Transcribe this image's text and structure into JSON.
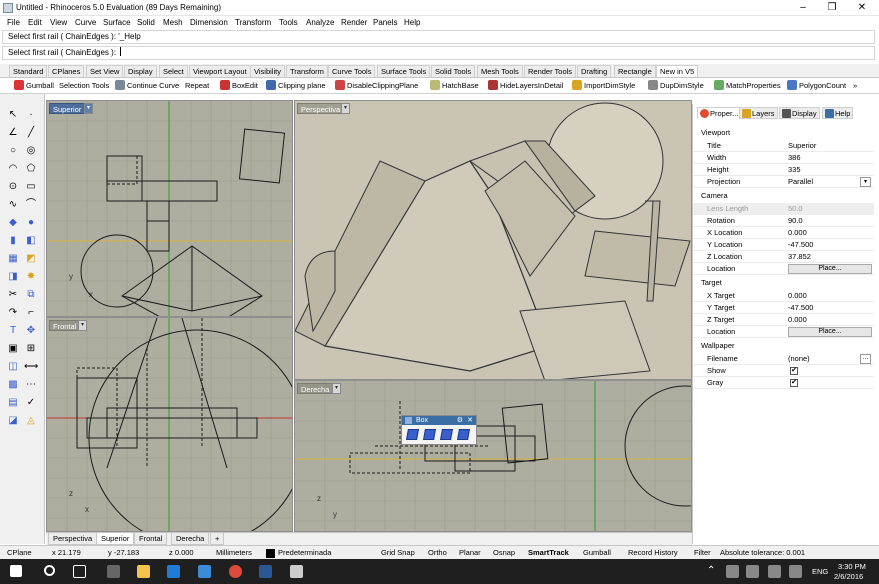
{
  "window": {
    "title": "Untitled - Rhinoceros 5.0 Evaluation (89 Days Remaining)",
    "min": "–",
    "max": "❐",
    "close": "✕"
  },
  "menu": [
    "File",
    "Edit",
    "View",
    "Curve",
    "Surface",
    "Solid",
    "Mesh",
    "Dimension",
    "Transform",
    "Tools",
    "Analyze",
    "Render",
    "Panels",
    "Help"
  ],
  "command": {
    "history": "Select first rail ( ChainEdges ): '_Help",
    "prompt": "Select first rail ( ChainEdges ):"
  },
  "toolbar_tabs": [
    "Standard",
    "CPlanes",
    "Set View",
    "Display",
    "Select",
    "Viewport Layout",
    "Visibility",
    "Transform",
    "Curve Tools",
    "Surface Tools",
    "Solid Tools",
    "Mesh Tools",
    "Render Tools",
    "Drafting",
    "Rectangle",
    "New in V5"
  ],
  "tools": [
    "Gumball",
    "Selection Tools",
    "Continue Curve",
    "Repeat",
    "BoxEdit",
    "Clipping plane",
    "DisableClippingPlane",
    "HatchBase",
    "HideLayersInDetail",
    "ImportDimStyle",
    "DupDimStyle",
    "MatchProperties",
    "PolygonCount"
  ],
  "tool_more": "»",
  "viewports": {
    "top": "Superior",
    "persp": "Perspectiva",
    "front": "Frontal",
    "right": "Derecha"
  },
  "viewport_tabs": [
    "Perspectiva",
    "Superior",
    "Frontal",
    "Derecha"
  ],
  "add_tab": "+",
  "axes": {
    "top": {
      "y": "y",
      "x": "x"
    },
    "front": {
      "z": "z",
      "x": "x"
    },
    "right": {
      "z": "z",
      "y": "y"
    }
  },
  "box_palette": {
    "title": "Box"
  },
  "panel": {
    "tabs": [
      "Proper...",
      "Layers",
      "Display",
      "Help"
    ],
    "viewport_section": "Viewport",
    "viewport_rows": [
      {
        "k": "Title",
        "v": "Superior"
      },
      {
        "k": "Width",
        "v": "386"
      },
      {
        "k": "Height",
        "v": "335"
      },
      {
        "k": "Projection",
        "v": "Parallel"
      }
    ],
    "camera_section": "Camera",
    "camera_rows": [
      {
        "k": "Lens Length",
        "v": "50.0"
      },
      {
        "k": "Rotation",
        "v": "90.0"
      },
      {
        "k": "X Location",
        "v": "0.000"
      },
      {
        "k": "Y Location",
        "v": "-47.500"
      },
      {
        "k": "Z Location",
        "v": "37.852"
      },
      {
        "k": "Location",
        "v": "Place..."
      }
    ],
    "target_section": "Target",
    "target_rows": [
      {
        "k": "X Target",
        "v": "0.000"
      },
      {
        "k": "Y Target",
        "v": "-47.500"
      },
      {
        "k": "Z Target",
        "v": "0.000"
      },
      {
        "k": "Location",
        "v": "Place..."
      }
    ],
    "wallpaper_section": "Wallpaper",
    "wallpaper_rows": [
      {
        "k": "Filename",
        "v": "(none)"
      },
      {
        "k": "Show",
        "v": "✔"
      },
      {
        "k": "Gray",
        "v": "✔"
      }
    ]
  },
  "status": {
    "cplane": "CPlane",
    "x": "x 21.179",
    "y": "y -27.183",
    "z": "z 0.000",
    "units": "Millimeters",
    "layer": "Predeterminada",
    "grid_snap": "Grid Snap",
    "ortho": "Ortho",
    "planar": "Planar",
    "osnap": "Osnap",
    "smarttrack": "SmartTrack",
    "gumball": "Gumball",
    "record_history": "Record History",
    "filter": "Filter",
    "tolerance": "Absolute tolerance: 0.001"
  },
  "taskbar": {
    "lang": "ENG",
    "time": "3:30 PM",
    "date": "2/6/2016"
  },
  "colors": {
    "viewport_bg": "#aeaea0",
    "active_label": "#4d6d9d",
    "grid_x": "#c2342b",
    "grid_y": "#2f9d2f",
    "accent": "#3a6ea5"
  }
}
